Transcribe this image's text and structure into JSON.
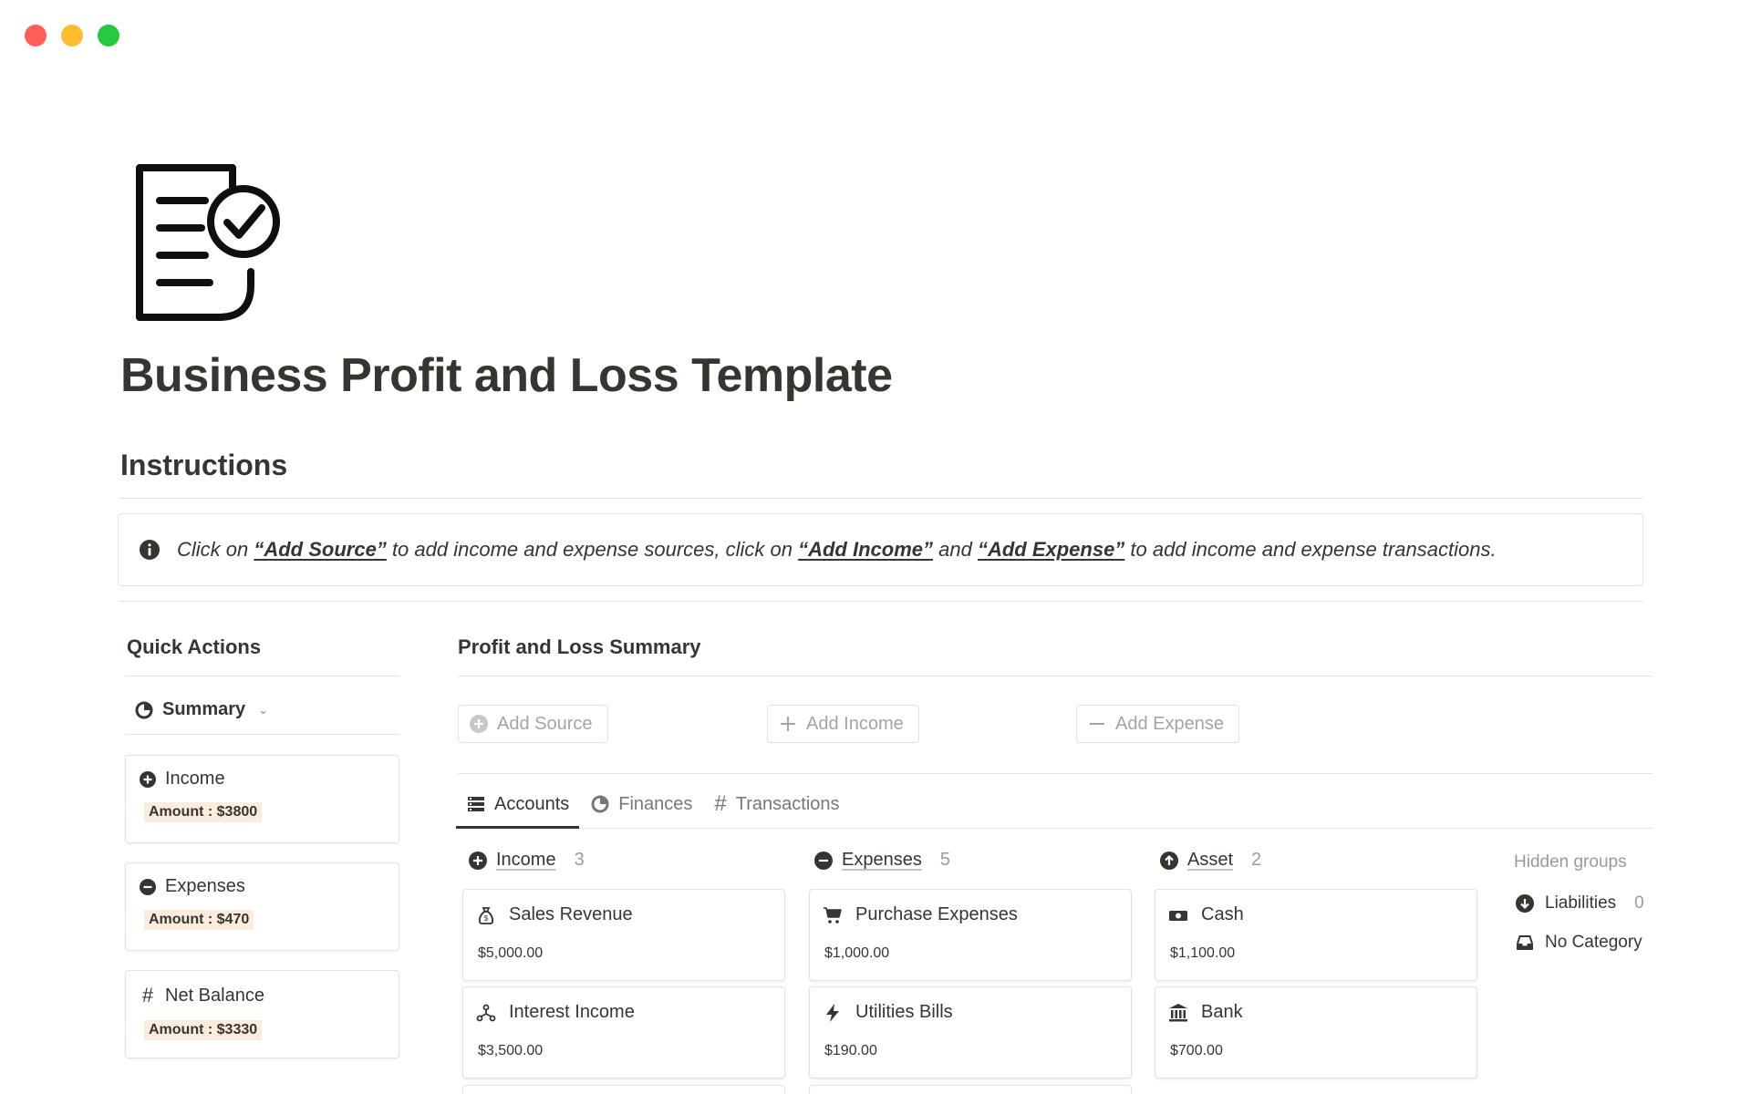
{
  "page": {
    "title": "Business Profit and Loss Template",
    "icon": "checklist-document-icon"
  },
  "instructions": {
    "heading": "Instructions",
    "callout": {
      "icon": "info-icon",
      "part1": "Click on ",
      "link1": "“Add Source”",
      "part2": " to add income and expense sources, click on ",
      "link2": "“Add Income”",
      "part3": " and ",
      "link3": "“Add Expense”",
      "part4": " to add income and expense transactions."
    }
  },
  "quick_actions": {
    "title": "Quick Actions",
    "view_label": "Summary",
    "cards": [
      {
        "label": "Income",
        "icon": "plus-circle-icon",
        "amount": "Amount : $3800"
      },
      {
        "label": "Expenses",
        "icon": "minus-circle-icon",
        "amount": "Amount : $470"
      },
      {
        "label": "Net Balance",
        "icon": "hash-icon",
        "amount": "Amount : $3330"
      }
    ]
  },
  "summary": {
    "title": "Profit and Loss Summary",
    "buttons": {
      "add_source": "Add Source",
      "add_income": "Add Income",
      "add_expense": "Add Expense"
    },
    "tabs": [
      "Accounts",
      "Finances",
      "Transactions"
    ],
    "groups": [
      {
        "name": "Income",
        "count": "3",
        "icon": "plus-circle-icon",
        "cards": [
          {
            "name": "Sales Revenue",
            "value": "$5,000.00",
            "icon": "money-bag-icon"
          },
          {
            "name": "Interest Income",
            "value": "$3,500.00",
            "icon": "network-icon"
          }
        ]
      },
      {
        "name": "Expenses",
        "count": "5",
        "icon": "minus-circle-icon",
        "cards": [
          {
            "name": "Purchase Expenses",
            "value": "$1,000.00",
            "icon": "cart-icon"
          },
          {
            "name": "Utilities Bills",
            "value": "$190.00",
            "icon": "lightning-icon"
          }
        ]
      },
      {
        "name": "Asset",
        "count": "2",
        "icon": "arrow-up-circle-icon",
        "cards": [
          {
            "name": "Cash",
            "value": "$1,100.00",
            "icon": "cash-icon"
          },
          {
            "name": "Bank",
            "value": "$700.00",
            "icon": "bank-icon"
          }
        ]
      }
    ],
    "hidden_groups": {
      "title": "Hidden groups",
      "items": [
        {
          "name": "Liabilities",
          "count": "0",
          "icon": "arrow-down-circle-icon"
        },
        {
          "name": "No Category",
          "icon": "inbox-icon"
        }
      ]
    }
  }
}
